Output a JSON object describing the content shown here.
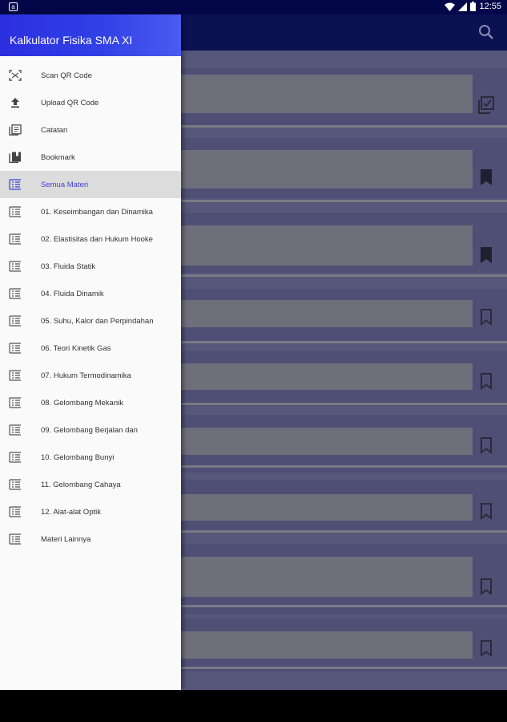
{
  "status_bar": {
    "time": "12:55",
    "notification_glyph": "a"
  },
  "app_bar": {
    "search_icon": "search-icon"
  },
  "drawer": {
    "title": "Kalkulator Fisika SMA XI",
    "items": [
      {
        "label": "Scan QR Code",
        "icon": "qr-scan-icon"
      },
      {
        "label": "Upload QR Code",
        "icon": "upload-icon"
      },
      {
        "label": "Catatan",
        "icon": "notes-icon"
      },
      {
        "label": "Bookmark",
        "icon": "bookmark-book-icon"
      },
      {
        "label": "Semua Materi",
        "icon": "list-icon",
        "active": true
      },
      {
        "label": "01. Keseimbangan dan Dinamika",
        "icon": "list-icon"
      },
      {
        "label": "02. Elastisitas dan Hukum Hooke",
        "icon": "list-icon"
      },
      {
        "label": "03. Fluida Statik",
        "icon": "list-icon"
      },
      {
        "label": "04. Fluida Dinamik",
        "icon": "list-icon"
      },
      {
        "label": "05. Suhu, Kalor dan Perpindahan",
        "icon": "list-icon"
      },
      {
        "label": "06. Teori Kinetik Gas",
        "icon": "list-icon"
      },
      {
        "label": "07. Hukum Termodinamika",
        "icon": "list-icon"
      },
      {
        "label": "08. Gelombang Mekanik",
        "icon": "list-icon"
      },
      {
        "label": "09. Gelombang Berjalan dan",
        "icon": "list-icon"
      },
      {
        "label": "10. Gelombang Bunyi",
        "icon": "list-icon"
      },
      {
        "label": "11. Gelombang Cahaya",
        "icon": "list-icon"
      },
      {
        "label": "12. Alat-alat Optik",
        "icon": "list-icon"
      },
      {
        "label": "Materi Lainnya",
        "icon": "list-icon"
      }
    ]
  },
  "colors": {
    "status_bar": "#03074a",
    "drawer_header_start": "#2c2fe0",
    "drawer_header_end": "#4a5bf0",
    "active_label": "#3d3fd6",
    "active_bg": "#dcdcdc"
  },
  "background_cards": [
    {
      "bookmark_state": "checked"
    },
    {
      "bookmark_state": "filled"
    },
    {
      "bookmark_state": "filled"
    },
    {
      "bookmark_state": "outline"
    },
    {
      "bookmark_state": "outline"
    },
    {
      "bookmark_state": "outline"
    },
    {
      "bookmark_state": "outline"
    },
    {
      "bookmark_state": "outline"
    },
    {
      "bookmark_state": "outline"
    }
  ]
}
